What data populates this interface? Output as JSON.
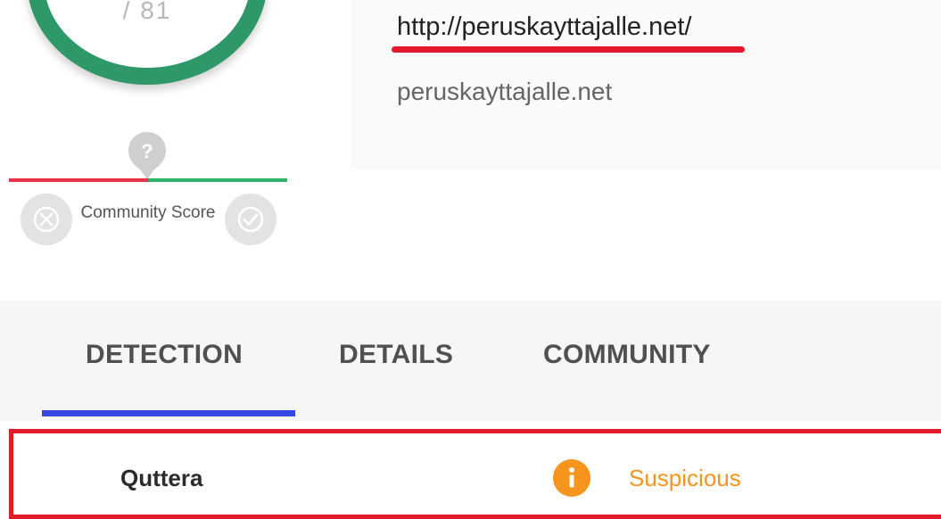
{
  "score_gauge": {
    "total_partial": "/ 81"
  },
  "community_score": {
    "label": "Community Score",
    "marker_icon": "question-mark-icon",
    "colors": {
      "negative": "#e8334a",
      "positive": "#2fb36b"
    }
  },
  "url_info": {
    "url": "http://peruskayttajalle.net/",
    "domain": "peruskayttajalle.net"
  },
  "tabs": [
    {
      "label": "DETECTION",
      "active": true
    },
    {
      "label": "DETAILS",
      "active": false
    },
    {
      "label": "COMMUNITY",
      "active": false
    }
  ],
  "detection_result": {
    "engine": "Quttera",
    "verdict": "Suspicious",
    "verdict_icon": "info-icon",
    "verdict_color": "#f7941d"
  },
  "colors": {
    "gauge_ring": "#2f9868",
    "highlight": "#e31b2a",
    "tab_indicator": "#3548e6"
  }
}
